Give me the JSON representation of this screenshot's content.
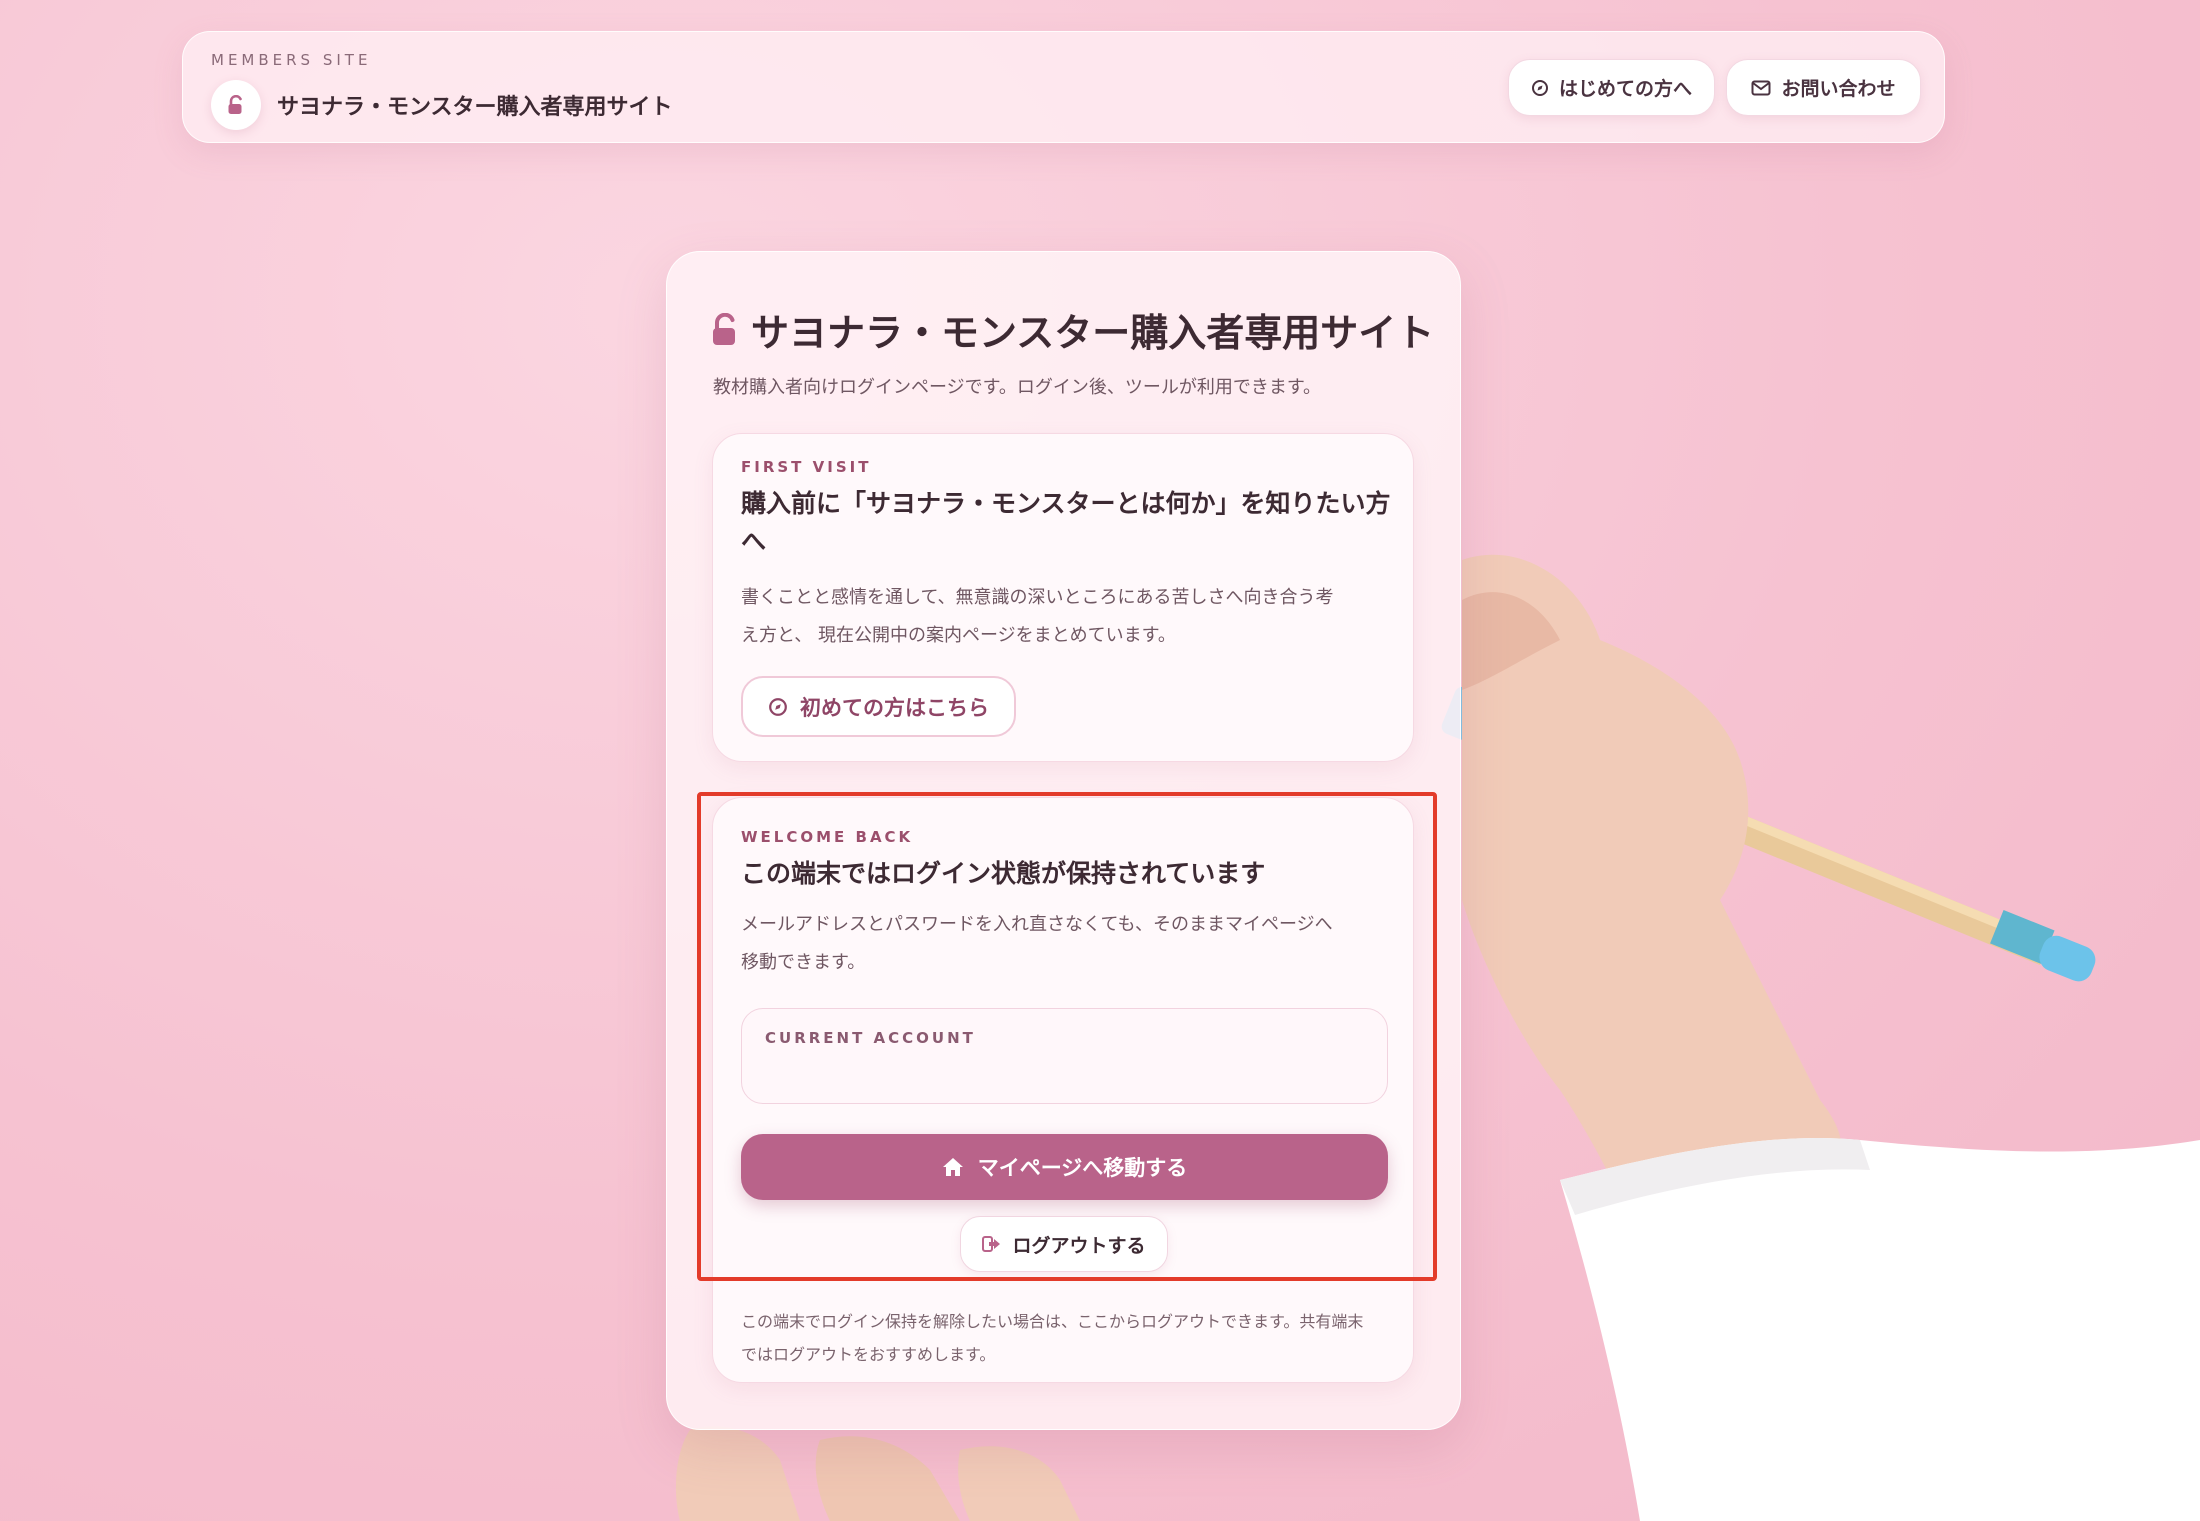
{
  "header": {
    "eyebrow": "MEMBERS SITE",
    "site_name": "サヨナラ・モンスター購入者専用サイト",
    "first_time_label": "はじめての方へ",
    "contact_label": "お問い合わせ"
  },
  "card": {
    "title": "サヨナラ・モンスター購入者専用サイト",
    "subtitle": "教材購入者向けログインページです。ログイン後、ツールが利用できます。"
  },
  "first_visit": {
    "eyebrow": "FIRST VISIT",
    "title_line1": "購入前に「サヨナラ・モンスターとは何か」を知りたい方",
    "title_line2": "へ",
    "text_line1": "書くことと感情を通して、無意識の深いところにある苦しさへ向き合う考",
    "text_line2": "え方と、 現在公開中の案内ページをまとめています。",
    "link_label": "初めての方はこちら"
  },
  "welcome": {
    "eyebrow": "WELCOME BACK",
    "title": "この端末ではログイン状態が保持されています",
    "text_line1": "メールアドレスとパスワードを入れ直さなくても、そのままマイページへ",
    "text_line2": "移動できます。",
    "account_label": "CURRENT ACCOUNT",
    "account_value": "",
    "mypage_label": "マイページへ移動する",
    "logout_label": "ログアウトする",
    "note_line1": "この端末でログイン保持を解除したい場合は、ここからログアウトできます。共有端末",
    "note_line2": "ではログアウトをおすすめします。"
  },
  "colors": {
    "accent": "#b9638a",
    "highlight": "#e33b2a",
    "background": "#f6c2d1"
  },
  "icons": {
    "lock": "unlock-icon",
    "compass": "compass-icon",
    "mail": "mail-icon",
    "home": "home-icon",
    "logout": "logout-icon"
  }
}
